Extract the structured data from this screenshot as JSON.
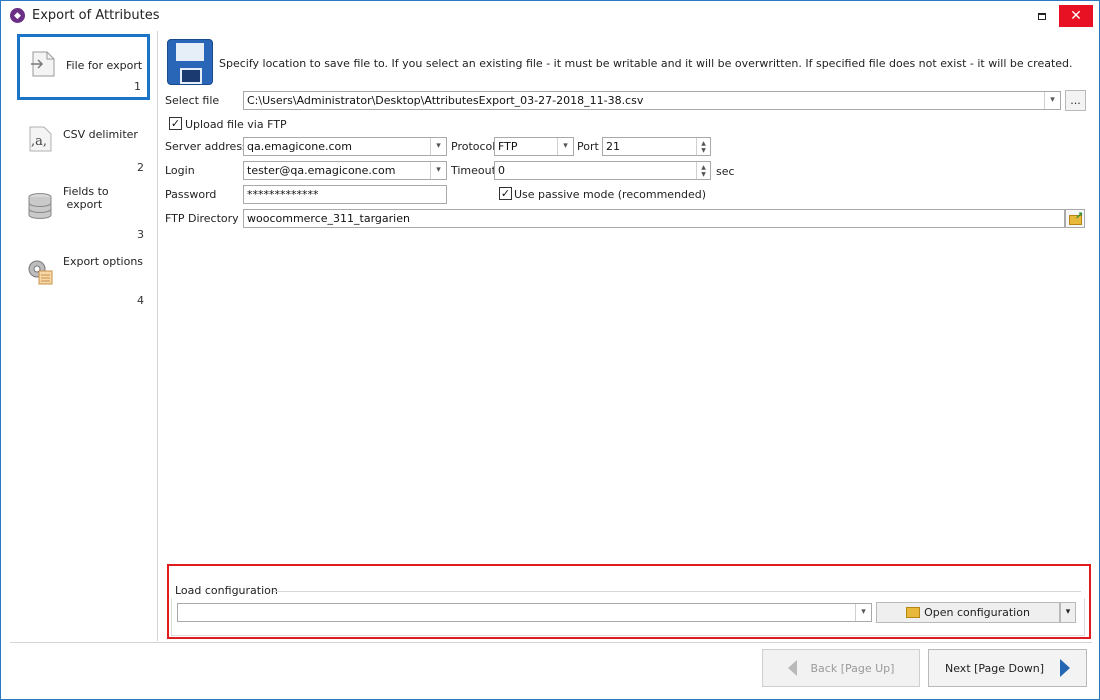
{
  "window": {
    "title": "Export of Attributes",
    "close_glyph": "✕",
    "accent_color": "#1c74c8",
    "highlight_color": "#e01b1b"
  },
  "nav": {
    "items": [
      {
        "label": "File for export",
        "number": "1",
        "icon": "file-arrow-icon"
      },
      {
        "label": "CSV delimiter",
        "number": "2",
        "icon": "csv-delimiter-icon"
      },
      {
        "label": "Fields to\n export",
        "number": "3",
        "icon": "database-icon"
      },
      {
        "label": "Export options",
        "number": "4",
        "icon": "gear-options-icon"
      }
    ]
  },
  "main": {
    "intro_text": "Specify location to save file to. If you select an existing file - it must be writable and it will be overwritten. If specified file does not exist - it will be created.",
    "select_file": {
      "label": "Select file",
      "value": "C:\\Users\\Administrator\\Desktop\\AttributesExport_03-27-2018_11-38.csv",
      "browse_label": "..."
    },
    "upload_ftp": {
      "label": "Upload file via FTP",
      "checked": true
    },
    "server": {
      "label": "Server address",
      "value": "qa.emagicone.com"
    },
    "protocol": {
      "label": "Protocol",
      "value": "FTP"
    },
    "port": {
      "label": "Port",
      "value": "21"
    },
    "login": {
      "label": "Login",
      "value": "tester@qa.emagicone.com"
    },
    "timeout": {
      "label": "Timeout",
      "value": "0",
      "unit": "sec"
    },
    "password": {
      "label": "Password",
      "value": "*************"
    },
    "passive": {
      "label": "Use passive mode (recommended)",
      "checked": true
    },
    "ftp_dir": {
      "label": "FTP Directory",
      "value": "woocommerce_311_targarien"
    }
  },
  "load_config": {
    "label": "Load configuration",
    "value": "",
    "open_label": "Open configuration"
  },
  "footer": {
    "back_label": "Back [Page Up]",
    "next_label": "Next [Page Down]"
  }
}
